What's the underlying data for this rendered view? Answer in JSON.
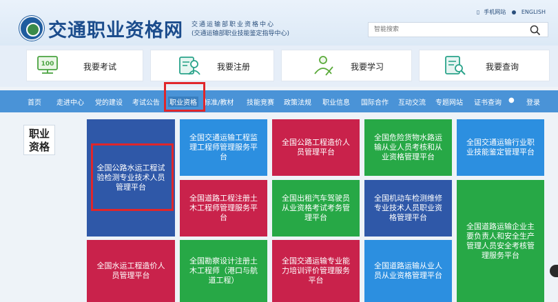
{
  "header": {
    "site_title": "交通职业资格网",
    "sub_title_line1": "交通运输部职业资格中心",
    "sub_title_line2": "(交通运输部职业技能鉴定指导中心)",
    "mobile_link": "手机网站",
    "english_link": "ENGLISH",
    "search_placeholder": "智能搜索"
  },
  "quick_entries": [
    {
      "label": "我要考试",
      "icon": "exam-icon"
    },
    {
      "label": "我要注册",
      "icon": "register-icon"
    },
    {
      "label": "我要学习",
      "icon": "study-icon"
    },
    {
      "label": "我要查询",
      "icon": "query-icon"
    }
  ],
  "nav": [
    {
      "label": "首页"
    },
    {
      "label": "走进中心"
    },
    {
      "label": "党的建设"
    },
    {
      "label": "考试公告"
    },
    {
      "label": "职业资格"
    },
    {
      "label": "标准/教材"
    },
    {
      "label": "技能竞赛"
    },
    {
      "label": "政策法规"
    },
    {
      "label": "职业信息"
    },
    {
      "label": "国际合作"
    },
    {
      "label": "互动交流"
    },
    {
      "label": "专题网站"
    },
    {
      "label": "证书查询"
    },
    {
      "label": "登录"
    }
  ],
  "side_label": {
    "line1": "职业",
    "line2": "资格"
  },
  "tiles": [
    {
      "text": "全国交通运输工程监理工程师管理服务平台"
    },
    {
      "text": "全国公路工程造价人员管理平台"
    },
    {
      "text": "全国危险货物水路运输从业人员考核和从业资格管理平台"
    },
    {
      "text": "全国交通运输行业职业技能鉴定管理平台"
    },
    {
      "text": "全国公路水运工程试验检测专业技术人员管理平台"
    },
    {
      "text": "全国道路工程注册土木工程师管理服务平台"
    },
    {
      "text": "全国出租汽车驾驶员从业资格考试考务管理平台"
    },
    {
      "text": "全国机动车检测维修专业技术人员职业资格管理平台"
    },
    {
      "text": "全国道路运输企业主要负责人和安全生产管理人员安全考核管理服务平台"
    },
    {
      "text": "全国水运工程造价人员管理平台"
    },
    {
      "text": "全国勘察设计注册土木工程师（港口与航道工程）"
    },
    {
      "text": "全国交通运输专业能力培训评价管理服务平台"
    },
    {
      "text": "全国道路运输从业人员从业资格管理平台"
    }
  ],
  "colors": {
    "nav_bg": "#4a93d7",
    "tile_dark_blue": "#2f58a8",
    "tile_blue": "#2c8fe0",
    "tile_red": "#c9224b",
    "tile_green": "#27a846",
    "highlight": "#e0262a"
  }
}
